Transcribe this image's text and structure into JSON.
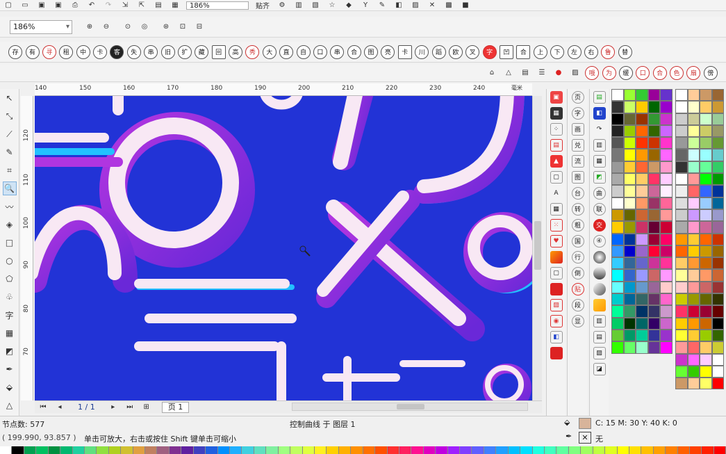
{
  "toolbar": {
    "zoom_value": "186%",
    "snap_label": "贴齐",
    "zoom_field_value": "186%"
  },
  "symbols_row": [
    "存",
    "有",
    "寻",
    "租",
    "中",
    "卡",
    "客",
    "失",
    "串",
    "旧",
    "扩",
    "藏",
    "回",
    "高",
    "秀",
    "大",
    "直",
    "自",
    "口",
    "串",
    "合",
    "图",
    "亮",
    "卡",
    "川",
    "蹈",
    "欧",
    "叉",
    "字",
    "凹",
    "合",
    "上",
    "下",
    "左",
    "右",
    "鲁",
    "替"
  ],
  "symbols_row2": [
    "哦",
    "为",
    "缓",
    "口",
    "合",
    "色",
    "扇",
    "傍"
  ],
  "ruler": {
    "unit": "毫米",
    "h_ticks": [
      "140",
      "150",
      "160",
      "170",
      "180",
      "190",
      "200",
      "210",
      "220",
      "230",
      "240"
    ],
    "v_ticks": [
      "120",
      "110",
      "100",
      "90",
      "80",
      "70"
    ]
  },
  "pagebar": {
    "page_count": "1 / 1",
    "page_tab": "页 1"
  },
  "docker_chars": [
    "页",
    "字",
    "画",
    "兑",
    "流",
    "图",
    "台",
    "转",
    "粗",
    "国",
    "行",
    "倒",
    "贴",
    "段",
    "显"
  ],
  "docker_chars3": [
    "曲",
    "联",
    "交"
  ],
  "status": {
    "node_count": "节点数: 577",
    "curve_info": "控制曲线 于 图层 1",
    "coords": "( 199.990, 93.857 )",
    "hint": "单击可放大，右击或按住 Shift 键单击可缩小",
    "fill_color": "C: 15 M: 30 Y: 40 K: 0",
    "outline_label": "无"
  },
  "colors": {
    "canvas_bg": "#2233d6",
    "fill_swatch": "#d8b49a"
  },
  "palette1": [
    "#ffffff",
    "#99ff33",
    "#33cc33",
    "#990099",
    "#6633cc",
    "#333333",
    "#ccff66",
    "#ffcc00",
    "#006600",
    "#9900cc",
    "#000000",
    "#666633",
    "#993300",
    "#339933",
    "#cc33cc",
    "#222222",
    "#99cc00",
    "#ff6600",
    "#336600",
    "#cc66ff",
    "#555555",
    "#ccff00",
    "#ff3300",
    "#cc3300",
    "#ff33cc",
    "#777777",
    "#ffff00",
    "#ff9900",
    "#996600",
    "#ff66ff",
    "#999999",
    "#ffcc33",
    "#ff6633",
    "#cc9966",
    "#ff99cc",
    "#aaaaaa",
    "#ffff66",
    "#ffcc66",
    "#ff3366",
    "#ffccff",
    "#cccccc",
    "#ffff99",
    "#ffcc99",
    "#cc6699",
    "#ffeeff",
    "#ffffff",
    "#ffffcc",
    "#ff9966",
    "#993366",
    "#ff6699",
    "#cc9900",
    "#666600",
    "#cc6633",
    "#996633",
    "#ff9999",
    "#ffcc00",
    "#999900",
    "#cc3366",
    "#660033",
    "#cc0033",
    "#0066ff",
    "#003399",
    "#cc99ff",
    "#990033",
    "#ff0066",
    "#3399ff",
    "#0000cc",
    "#9966cc",
    "#ff0033",
    "#cc0066",
    "#33ccff",
    "#336699",
    "#6666cc",
    "#cc3399",
    "#ff3399",
    "#00ffff",
    "#3366cc",
    "#9999ff",
    "#cc6666",
    "#ff99ff",
    "#66ffff",
    "#0099cc",
    "#6699cc",
    "#996699",
    "#ffcccc",
    "#00cccc",
    "#006699",
    "#336666",
    "#663366",
    "#ff66cc",
    "#00ff99",
    "#339966",
    "#003366",
    "#333366",
    "#cc99cc",
    "#00cc66",
    "#003300",
    "#006666",
    "#330066",
    "#cc66cc",
    "#66cc33",
    "#009966",
    "#00cc99",
    "#333399",
    "#9933cc",
    "#33ff00",
    "#66ff66",
    "#99ffcc",
    "#663399",
    "#ff00ff"
  ],
  "palette2": [
    "#ffffff",
    "#ffcc99",
    "#cc9966",
    "#996633",
    "#ffffff",
    "#ffffcc",
    "#ffcc66",
    "#cc9933",
    "#cccccc",
    "#cccc99",
    "#ccffcc",
    "#99cc99",
    "#cccccc",
    "#ffff99",
    "#cccc66",
    "#999966",
    "#999999",
    "#ccff99",
    "#99cc66",
    "#669933",
    "#666666",
    "#ccffff",
    "#99ffff",
    "#66cccc",
    "#333333",
    "#99ffcc",
    "#66ff99",
    "#33cc66",
    "#ffffff",
    "#ff9999",
    "#00ff00",
    "#009900",
    "#eeeeee",
    "#ff6666",
    "#3366ff",
    "#003399",
    "#dddddd",
    "#ffccff",
    "#99ccff",
    "#006699",
    "#cccccc",
    "#cc99ff",
    "#ccccff",
    "#9999cc",
    "#aaaaaa",
    "#ff99cc",
    "#cc6699",
    "#996699",
    "#ff9900",
    "#ffcc33",
    "#ff6600",
    "#cc3300",
    "#ff6600",
    "#ffcc00",
    "#cc9900",
    "#996600",
    "#ffcc66",
    "#ff9933",
    "#cc6600",
    "#993300",
    "#ffff99",
    "#ffcc99",
    "#ff9966",
    "#cc6633",
    "#ffcccc",
    "#ff9999",
    "#cc6666",
    "#993333",
    "#cccc00",
    "#999900",
    "#666600",
    "#333300",
    "#ff3366",
    "#cc0033",
    "#990033",
    "#660000",
    "#ffcc00",
    "#ff9900",
    "#cc6600",
    "#000000",
    "#ffff33",
    "#ffcc33",
    "#99cc00",
    "#336600",
    "#ff9999",
    "#ff6666",
    "#ffcc66",
    "#cccc33",
    "#cc33cc",
    "#ff66ff",
    "#ffccff",
    "#ffffff",
    "#66ff33",
    "#33cc00",
    "#ffff00",
    "#ffffff",
    "#cc9966",
    "#ffcc99",
    "#ffff66",
    "#ff0000"
  ],
  "bottom_palette": [
    "#ffffff",
    "#000000",
    "#00a050",
    "#00c060",
    "#009040",
    "#00b870",
    "#20d0a0",
    "#60e080",
    "#90e040",
    "#b0d020",
    "#d0c030",
    "#e0a040",
    "#c08060",
    "#a06080",
    "#803090",
    "#6020a0",
    "#4040c0",
    "#2060e0",
    "#0090ff",
    "#20b0ff",
    "#40d0e0",
    "#60e0c0",
    "#80f0a0",
    "#a0ff80",
    "#c0ff60",
    "#e0ff40",
    "#fff020",
    "#ffd000",
    "#ffb000",
    "#ff9000",
    "#ff7000",
    "#ff5000",
    "#ff3030",
    "#ff2060",
    "#ff1090",
    "#e000c0",
    "#c000e0",
    "#a020ff",
    "#8040ff",
    "#6060ff",
    "#4080ff",
    "#20a0ff",
    "#00c0ff",
    "#00e0ff",
    "#20ffe0",
    "#40ffc0",
    "#60ffa0",
    "#80ff80",
    "#a0ff60",
    "#c0ff40",
    "#e0ff20",
    "#ffff00",
    "#ffe000",
    "#ffc000",
    "#ffa000",
    "#ff8000",
    "#ff6000",
    "#ff4000",
    "#ff2000",
    "#ff0000"
  ]
}
